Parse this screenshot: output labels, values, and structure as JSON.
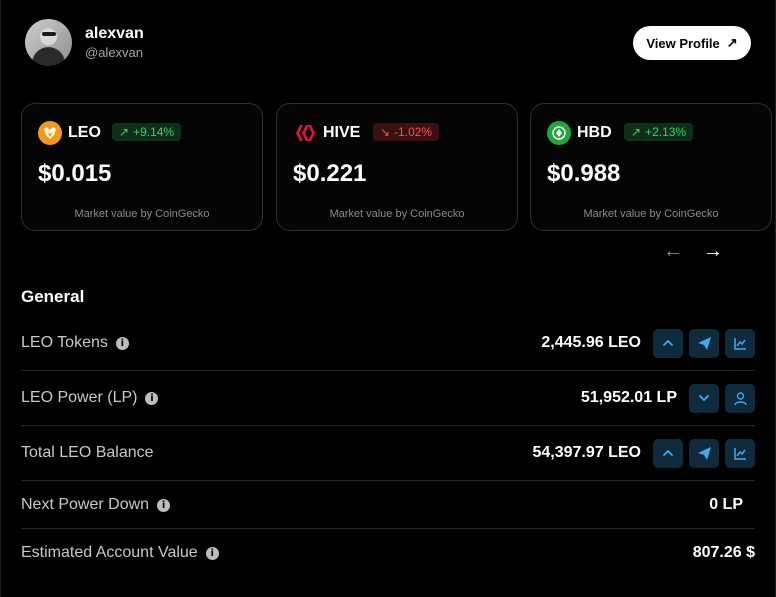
{
  "profile": {
    "username": "alexvan",
    "handle": "@alexvan",
    "view_profile_label": "View Profile",
    "view_profile_arrow": "↗"
  },
  "tokens": [
    {
      "symbol": "LEO",
      "change": "+9.14%",
      "trend": "up",
      "trend_arrow": "↗",
      "price": "$0.015",
      "note": "Market value by CoinGecko",
      "logo_color": "#f39a1e",
      "icon": "leo-logo-icon"
    },
    {
      "symbol": "HIVE",
      "change": "-1.02%",
      "trend": "down",
      "trend_arrow": "↘",
      "price": "$0.221",
      "note": "Market value by CoinGecko",
      "logo_color": "#e31337",
      "icon": "hive-logo-icon"
    },
    {
      "symbol": "HBD",
      "change": "+2.13%",
      "trend": "up",
      "trend_arrow": "↗",
      "price": "$0.988",
      "note": "Market value by CoinGecko",
      "logo_color": "#1ea83c",
      "icon": "hbd-logo-icon"
    }
  ],
  "carousel": {
    "prev": "←",
    "next": "→"
  },
  "general": {
    "title": "General",
    "rows": [
      {
        "label": "LEO Tokens",
        "value": "2,445.96 LEO",
        "info": "i"
      },
      {
        "label": "LEO Power (LP)",
        "value": "51,952.01 LP",
        "info": "i"
      },
      {
        "label": "Total LEO Balance",
        "value": "54,397.97 LEO"
      },
      {
        "label": "Next Power Down",
        "value": "0 LP",
        "info": "i"
      },
      {
        "label": "Estimated Account Value",
        "value": "807.26 $",
        "info": "i"
      }
    ]
  },
  "colors": {
    "accent_button_bg": "#0e2a3d",
    "accent_icon": "#3fa9f5"
  }
}
